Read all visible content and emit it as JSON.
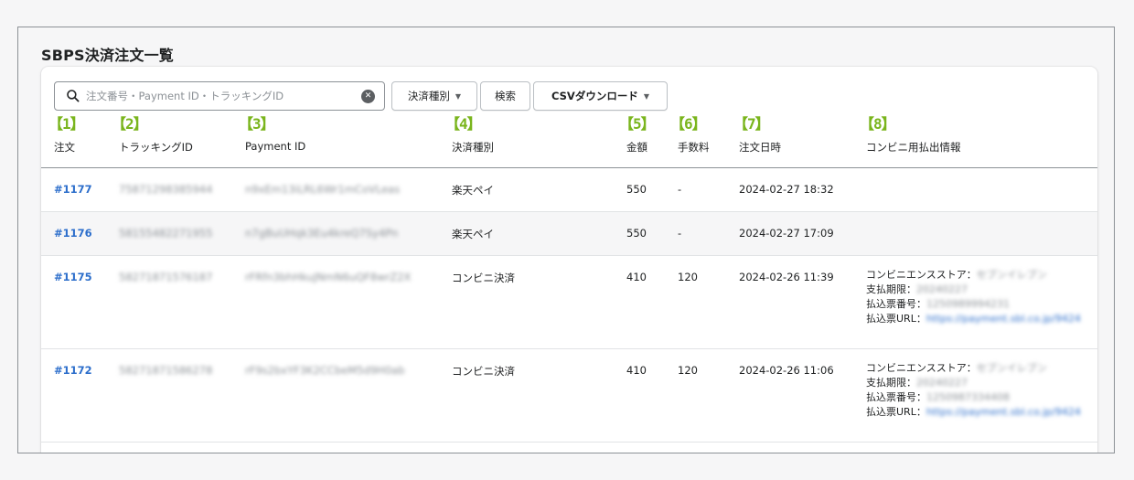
{
  "page": {
    "title": "SBPS決済注文一覧"
  },
  "toolbar": {
    "search_placeholder": "注文番号・Payment ID・トラッキングID",
    "type_button": "決済種別",
    "search_button": "検索",
    "csv_button": "CSVダウンロード"
  },
  "columns": [
    {
      "num": "【1】",
      "label": "注文"
    },
    {
      "num": "【2】",
      "label": "トラッキングID"
    },
    {
      "num": "【3】",
      "label": "Payment ID"
    },
    {
      "num": "【4】",
      "label": "決済種別"
    },
    {
      "num": "【5】",
      "label": "金額"
    },
    {
      "num": "【6】",
      "label": "手数料"
    },
    {
      "num": "【7】",
      "label": "注文日時"
    },
    {
      "num": "【8】",
      "label": "コンビニ用払出情報"
    }
  ],
  "orders": [
    {
      "order": "#1177",
      "tracking": "75871298385944",
      "payment_id": "n9xEm13iLRL6Wr1mCoVLeas",
      "type": "楽天ペイ",
      "amount": "550",
      "fee": "-",
      "date": "2024-02-27 18:32"
    },
    {
      "order": "#1176",
      "tracking": "58155482271955",
      "payment_id": "n7gBuUHqk3Eu4kreQ7Sy4Pn",
      "type": "楽天ペイ",
      "amount": "550",
      "fee": "-",
      "date": "2024-02-27 17:09"
    },
    {
      "order": "#1175",
      "tracking": "58271871576187",
      "payment_id": "rFRfn3bhHkuJNmN6uQF8wrZ2X",
      "type": "コンビニ決済",
      "amount": "410",
      "fee": "120",
      "date": "2024-02-26 11:39",
      "convenience": {
        "store_label": "コンビニエンスストア：",
        "store": "セブンイレブン",
        "deadline_label": "支払期限：",
        "deadline": "20240227",
        "slip_label": "払込票番号：",
        "slip": "1250989994231",
        "url_label": "払込票URL：",
        "url": "https://payment.sbl.co.jp/9424"
      }
    },
    {
      "order": "#1172",
      "tracking": "58271871586278",
      "payment_id": "rF9s2bxYF3K2CCbeM5d9H0ab",
      "type": "コンビニ決済",
      "amount": "410",
      "fee": "120",
      "date": "2024-02-26 11:06",
      "convenience": {
        "store_label": "コンビニエンスストア：",
        "store": "セブンイレブン",
        "deadline_label": "支払期限：",
        "deadline": "20240227",
        "slip_label": "払込票番号：",
        "slip": "1250987334408",
        "url_label": "払込票URL：",
        "url": "https://payment.sbl.co.jp/9424"
      }
    }
  ]
}
